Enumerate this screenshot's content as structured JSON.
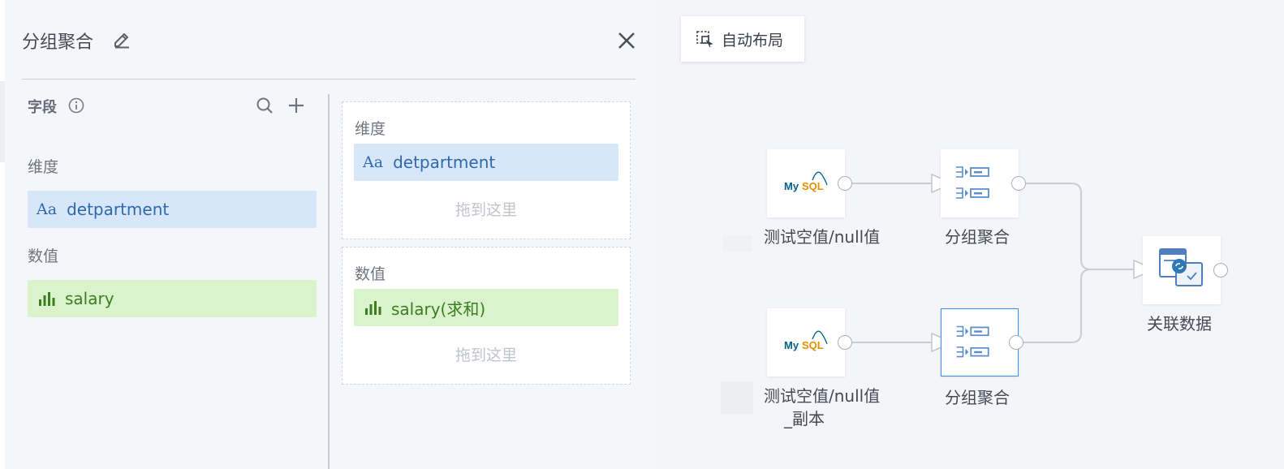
{
  "panel": {
    "title": "分组聚合",
    "fields": {
      "header": "字段",
      "dimension_label": "维度",
      "dimension_items": [
        "detpartment"
      ],
      "measure_label": "数值",
      "measure_items": [
        "salary"
      ]
    },
    "config": {
      "dimension_label": "维度",
      "dimension_chip": "detpartment",
      "dimension_hint": "拖到这里",
      "measure_label": "数值",
      "measure_chip": "salary(求和)",
      "measure_hint": "拖到这里"
    }
  },
  "canvas": {
    "auto_layout_label": "自动布局",
    "nodes": {
      "source1": "测试空值/null值",
      "group1": "分组聚合",
      "source2_line1": "测试空值/null值",
      "source2_line2": "_副本",
      "group2": "分组聚合",
      "join": "关联数据"
    },
    "mysql_text": "MySQL"
  },
  "colors": {
    "dimension_chip_bg": "#d7e6f8",
    "measure_chip_bg": "#dbf3cc",
    "selected_border": "#3b8cf0"
  }
}
